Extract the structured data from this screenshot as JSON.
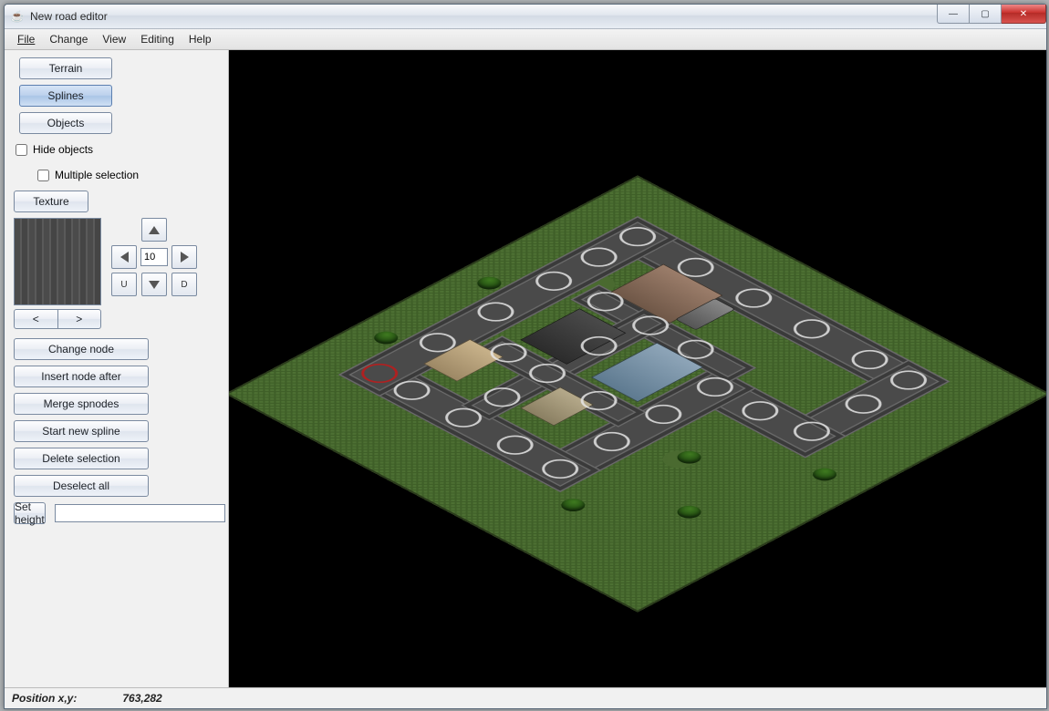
{
  "window": {
    "title": "New road editor",
    "buttons": {
      "min": "—",
      "max": "▢",
      "close": "✕"
    }
  },
  "menubar": [
    "File",
    "Change",
    "View",
    "Editing",
    "Help"
  ],
  "sidebar": {
    "mode_buttons": {
      "terrain": "Terrain",
      "splines": "Splines",
      "objects": "Objects"
    },
    "selected_mode": "splines",
    "hide_objects_label": "Hide objects",
    "hide_objects_checked": false,
    "multiple_selection_label": "Multiple selection",
    "multiple_selection_checked": false,
    "texture_button": "Texture",
    "navpad": {
      "value": "10",
      "u_label": "U",
      "d_label": "D"
    },
    "texnav": {
      "prev": "<",
      "next": ">"
    },
    "actions": {
      "change_node": "Change node",
      "insert_node_after": "Insert node after",
      "merge_spnodes": "Merge spnodes",
      "start_new_spline": "Start new spline",
      "delete_selection": "Delete selection",
      "deselect_all": "Deselect all"
    },
    "set_height_label": "Set height",
    "set_height_value": ""
  },
  "statusbar": {
    "label": "Position x,y:",
    "value": "763,282"
  },
  "icons": {
    "java": "☕"
  }
}
